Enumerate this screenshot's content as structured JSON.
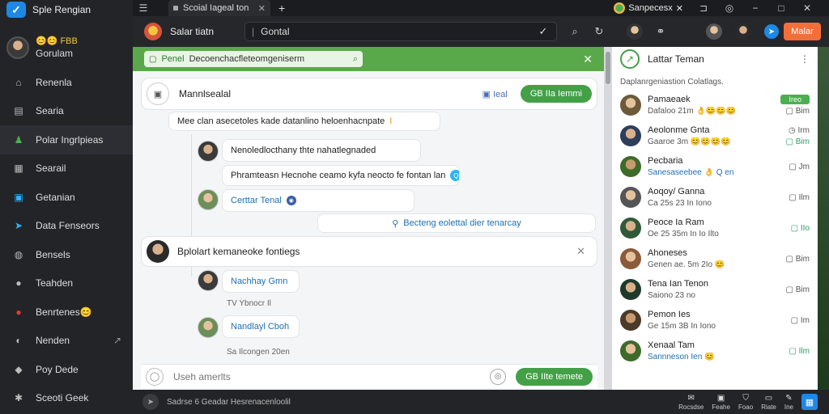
{
  "app": {
    "title": "Sple Rengian"
  },
  "profile": {
    "status": "😊😊 FBB",
    "name": "Gorulam"
  },
  "sidebar": {
    "items": [
      {
        "label": "Renenla",
        "icon": "home-icon"
      },
      {
        "label": "Searia",
        "icon": "feed-icon"
      },
      {
        "label": "Polar Ingrlpieas",
        "icon": "people-icon"
      },
      {
        "label": "Searail",
        "icon": "grid-icon"
      },
      {
        "label": "Getanian",
        "icon": "calendar-icon"
      },
      {
        "label": "Data Fenseors",
        "icon": "twitter-icon"
      },
      {
        "label": "Bensels",
        "icon": "globe-icon"
      },
      {
        "label": "Teahden",
        "icon": "user-icon"
      },
      {
        "label": "Benrtenes😊",
        "icon": "bell-icon"
      },
      {
        "label": "Nenden",
        "icon": "compass-icon",
        "extra": "↗"
      },
      {
        "label": "Poy Dede",
        "icon": "settings-icon"
      },
      {
        "label": "Sceoti Geek",
        "icon": "gear-icon"
      }
    ]
  },
  "titlebar": {
    "tab_label": "Scoial Iageal ton",
    "chip_label": "Sanpecesx",
    "chip_close": "✕"
  },
  "toolbar": {
    "title": "Salar tiatn",
    "search_value": "Gontal",
    "upgrade_label": "Malar"
  },
  "main": {
    "top_tag": "Penel",
    "top_text": "Decoenchacfleteomgeniserm",
    "card_title": "Mannlsealal",
    "card_count": "Ieal",
    "card_button": "GB IIa Iemmi",
    "messages": [
      {
        "text": "Mee clan asecetoles kade datanlino heloenhacnpate",
        "tag": "I"
      },
      {
        "text": "Nenoledlocthany thte nahatlegnaded"
      },
      {
        "text": "Phramteasn Hecnohe ceamo kyfa neocto fe fontan lan",
        "badge": "Q"
      },
      {
        "text": "Certtar Tenal"
      },
      {
        "text": "Becteng eolettal dier tenarcay"
      }
    ],
    "card2_title": "Bplolart kemaneoke fontiegs",
    "replies": [
      {
        "name": "Nachhay Gmn",
        "meta": "TV Ybnocr Il"
      },
      {
        "name": "Nandlayl Cboh",
        "meta": "Sa Ilcongen 20en"
      }
    ],
    "composer_placeholder": "Useh amerlts",
    "composer_button": "GB IIte temete"
  },
  "rpanel": {
    "title": "Lattar Teman",
    "subtitle": "Daplanrgeniastion Colatlags.",
    "contacts": [
      {
        "name": "Pamaeaek",
        "sub": "Dafaloo 21m 👌😊😊😊",
        "right_top": "Ireo",
        "right_bottom": "Bim",
        "badge": true
      },
      {
        "name": "Aeolonme Gnta",
        "sub": "Gaaroe 3m 😊😊😊😊",
        "right_top": "Irm",
        "right_bottom": "Bim",
        "right_bottom_green": true
      },
      {
        "name": "Pecbaria",
        "sub": "Sanesaseebee 👌 Q en",
        "sub_blue": true,
        "right_top": "",
        "right_bottom": "Jm"
      },
      {
        "name": "Aoqoy/ Ganna",
        "sub": "Ca 25s 23 In Iono",
        "right_top": "",
        "right_bottom": "Ilm"
      },
      {
        "name": "Peoce Ia Ram",
        "sub": "Oe 25 35m In Io Ilto",
        "right_top": "",
        "right_bottom": "IIo",
        "right_bottom_green": true
      },
      {
        "name": "Ahoneses",
        "sub": "Genen ae. 5m 2Io 😊",
        "right_top": "",
        "right_bottom": "Bim"
      },
      {
        "name": "Tena Ian Tenon",
        "sub": "Saiono 23 no",
        "right_top": "",
        "right_bottom": "Bim"
      },
      {
        "name": "Pemon Ies",
        "sub": "Ge 15m 3B In Iono",
        "right_top": "",
        "right_bottom": "Im"
      },
      {
        "name": "Xenaal Tam",
        "sub": "Sannneson Ien 😊",
        "sub_blue": true,
        "right_top": "",
        "right_bottom": "Ilm",
        "right_bottom_green": true
      }
    ]
  },
  "statusbar": {
    "text": "Sadrse 6 Geadar Hesrenacenloolil",
    "items": [
      {
        "label": "Rocsdse",
        "icon": "mail-icon"
      },
      {
        "label": "Feahe",
        "icon": "image-icon"
      },
      {
        "label": "Foao",
        "icon": "shield-icon"
      },
      {
        "label": "Riate",
        "icon": "inbox-icon"
      },
      {
        "label": "Ine",
        "icon": "edit-icon"
      }
    ]
  },
  "colors": {
    "accent_green": "#59a84a",
    "accent_orange": "#f36f3a",
    "brand_blue": "#1e88e5"
  }
}
